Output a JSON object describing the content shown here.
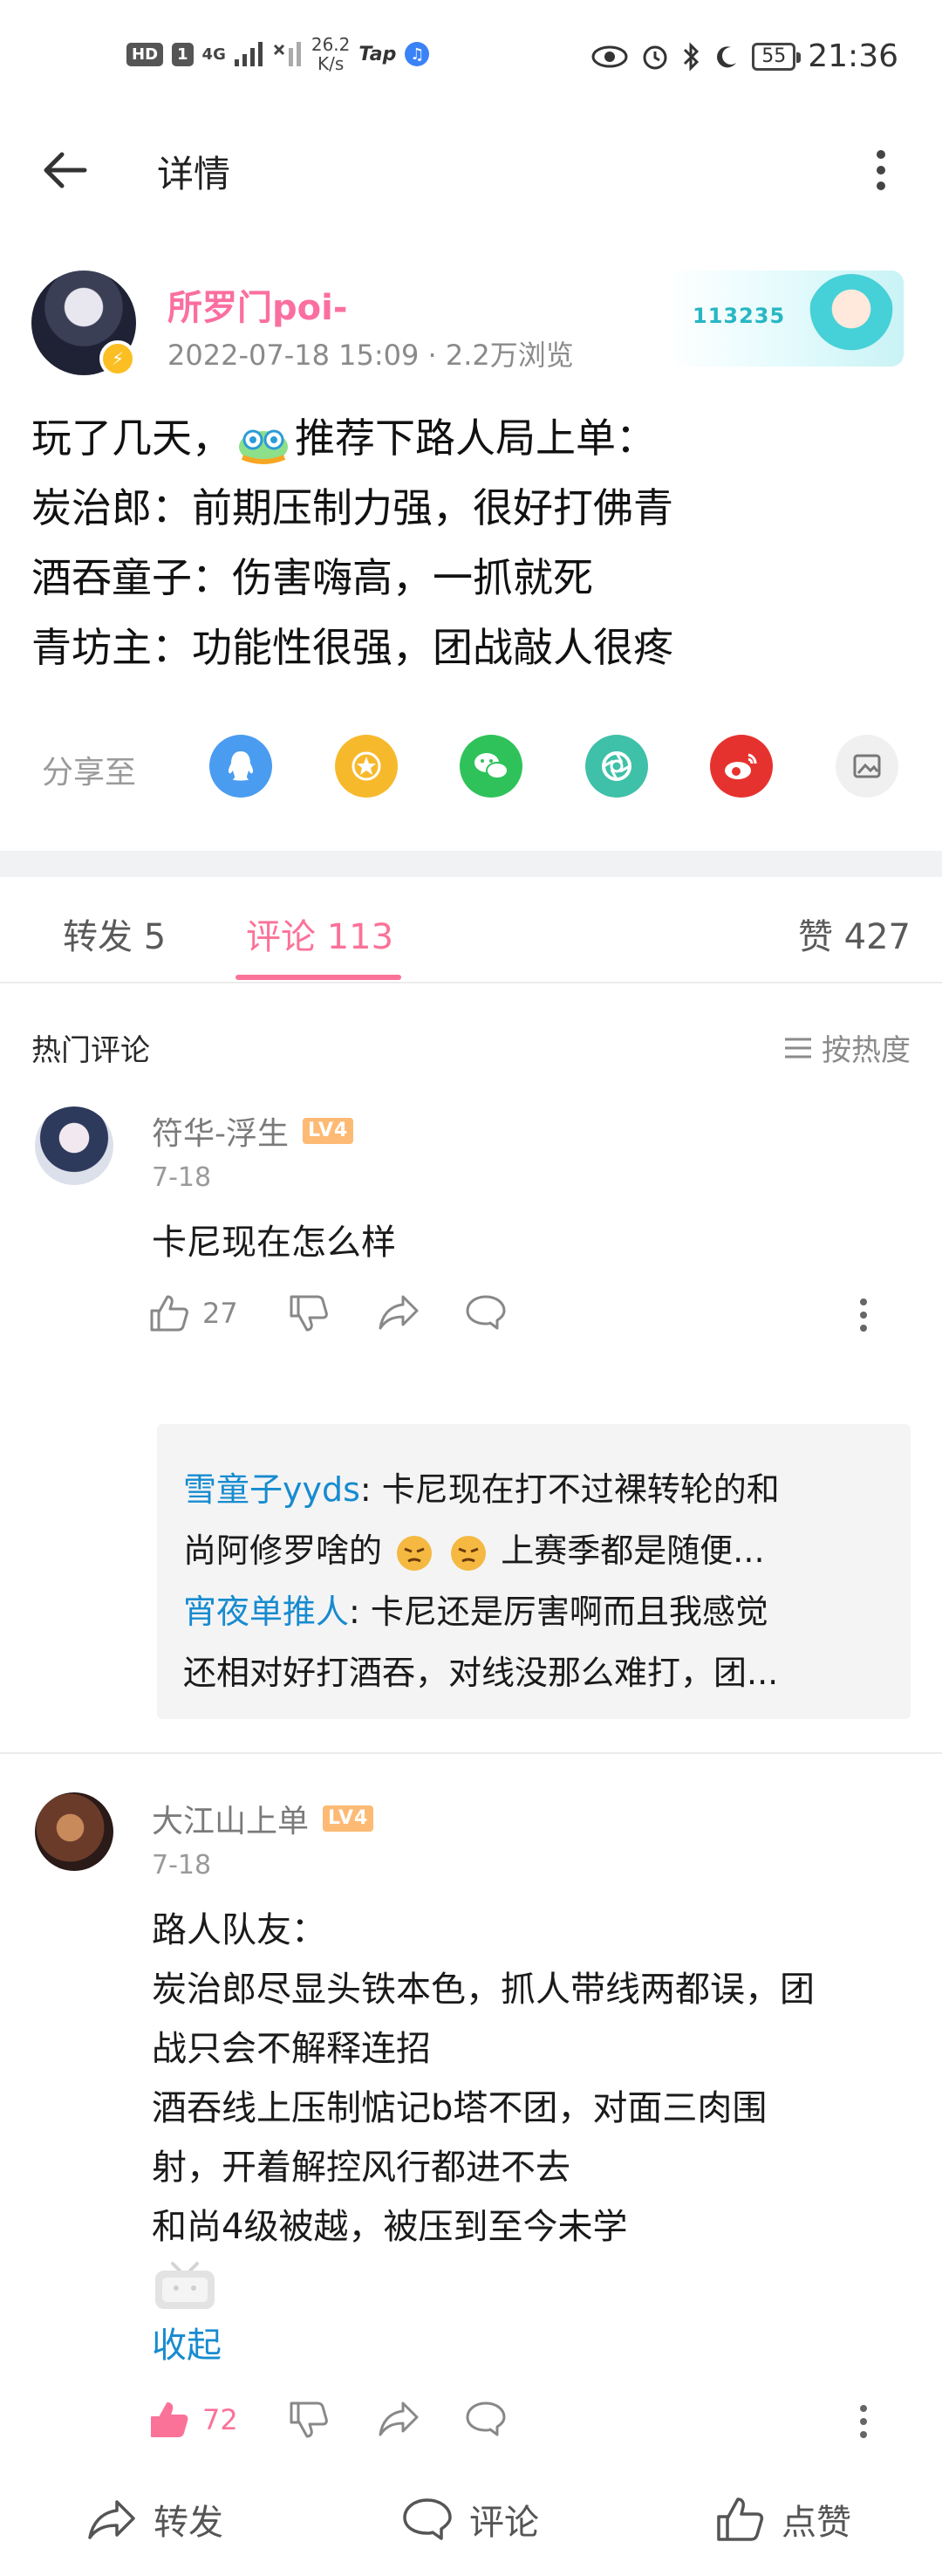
{
  "status_bar": {
    "hd": "HD",
    "sim": "1",
    "net_type": "4G",
    "speed_value": "26.2",
    "speed_unit": "K/s",
    "tap": "Tap",
    "battery": "55",
    "time": "21:36"
  },
  "header": {
    "title": "详情"
  },
  "post": {
    "author_name": "所罗门poi-",
    "meta": "2022-07-18 15:09 · 2.2万浏览",
    "badge_number": "113235",
    "lines": [
      {
        "before": "玩了几天，",
        "after": "推荐下路人局上单："
      },
      "炭治郎：前期压制力强，很好打佛青",
      "酒吞童子：伤害嗨高，一抓就死",
      "青坊主：功能性很强，团战敲人很疼"
    ]
  },
  "share": {
    "label": "分享至",
    "targets": [
      {
        "name": "qq",
        "icon": "qq-icon",
        "color": "#4a9cf0"
      },
      {
        "name": "qzone",
        "icon": "star-icon",
        "color": "#f7b92c"
      },
      {
        "name": "wechat",
        "icon": "wechat-icon",
        "color": "#2fc25b"
      },
      {
        "name": "moments",
        "icon": "aperture-icon",
        "color": "#3fc0a8"
      },
      {
        "name": "weibo",
        "icon": "weibo-icon",
        "color": "#e6322e"
      },
      {
        "name": "image",
        "icon": "image-icon",
        "color": "#f0f0f0"
      }
    ]
  },
  "tabs": {
    "repost": "转发 5",
    "comments": "评论 113",
    "likes": "赞 427"
  },
  "hot": {
    "title": "热门评论",
    "sort": "按热度"
  },
  "comments": [
    {
      "user": "符华-浮生",
      "level": "LV4",
      "time": "7-18",
      "body": "卡尼现在怎么样",
      "likes": "27",
      "replies": [
        {
          "user": "雪童子yyds",
          "text_a": ": 卡尼现在打不过裸转轮的和",
          "text_b": "尚阿修罗啥的",
          "text_c": "上赛季都是随便..."
        },
        {
          "user": "宵夜单推人",
          "text_a": ": 卡尼还是厉害啊而且我感觉",
          "text_b": "还相对好打酒吞，对线没那么难打，团..."
        }
      ]
    },
    {
      "user": "大江山上单",
      "level": "LV4",
      "time": "7-18",
      "body_lines": [
        "路人队友：",
        "炭治郎尽显头铁本色，抓人带线两都误，团",
        "战只会不解释连招",
        "酒吞线上压制惦记b塔不团，对面三肉围",
        "射，开着解控风行都进不去",
        "和尚4级被越，被压到至今未学"
      ],
      "collapse": "收起",
      "likes": "72"
    }
  ],
  "bottom_bar": {
    "repost": "转发",
    "comment": "评论",
    "like": "点赞"
  },
  "colors": {
    "accent": "#fb7299",
    "link": "#178bcf",
    "author": "#fb6fa0"
  }
}
